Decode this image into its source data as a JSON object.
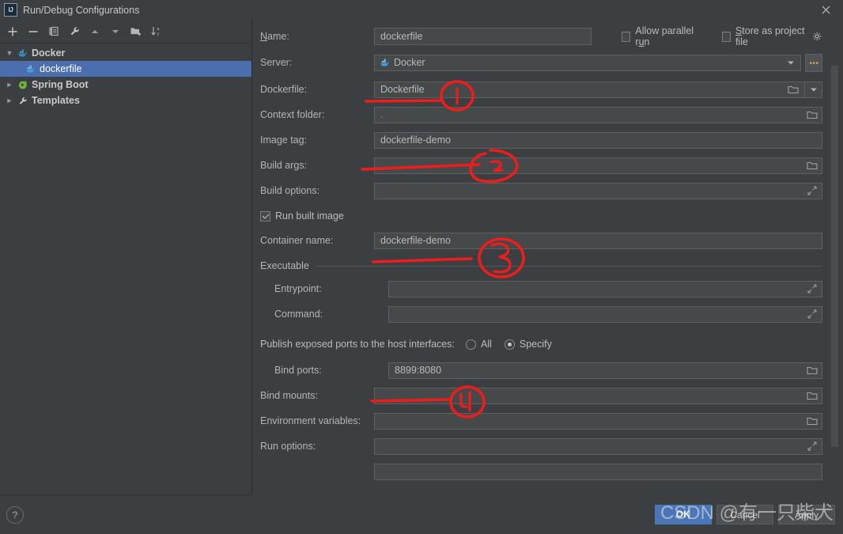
{
  "window": {
    "title": "Run/Debug Configurations",
    "logo_text": "IJ",
    "close_icon": "close-icon"
  },
  "toolbar": {
    "items": [
      {
        "name": "add-configuration-button",
        "icon": "plus-icon",
        "tooltip": "Add New Configuration"
      },
      {
        "name": "remove-configuration-button",
        "icon": "minus-icon",
        "tooltip": "Remove Configuration"
      },
      {
        "name": "copy-configuration-button",
        "icon": "copy-icon",
        "tooltip": "Copy Configuration"
      },
      {
        "name": "edit-templates-button",
        "icon": "wrench-icon",
        "tooltip": "Edit Templates"
      },
      {
        "name": "move-up-button",
        "icon": "arrow-up-icon",
        "tooltip": "Move Up"
      },
      {
        "name": "move-down-button",
        "icon": "arrow-down-icon",
        "tooltip": "Move Down"
      },
      {
        "name": "move-into-folder-button",
        "icon": "folder-add-icon",
        "tooltip": "Move into new folder"
      },
      {
        "name": "sort-configurations-button",
        "icon": "sort-az-icon",
        "tooltip": "Sort Configurations"
      }
    ]
  },
  "tree": {
    "nodes": [
      {
        "label": "Docker",
        "icon": "docker-icon",
        "twisty": "expanded",
        "selected": false,
        "indent": false
      },
      {
        "label": "dockerfile",
        "icon": "docker-icon",
        "twisty": "none",
        "selected": true,
        "indent": true
      },
      {
        "label": "Spring Boot",
        "icon": "spring-icon",
        "twisty": "collapsed",
        "selected": false,
        "indent": false
      },
      {
        "label": "Templates",
        "icon": "wrench-icon",
        "twisty": "collapsed",
        "selected": false,
        "indent": false
      }
    ]
  },
  "form": {
    "name": {
      "label": "Name:",
      "mnemonic": "N",
      "value": "dockerfile"
    },
    "allow_parallel_run": {
      "label_pre": "Allow parallel r",
      "mnemonic": "u",
      "label_post": "n",
      "checked": false
    },
    "store_as_project_file": {
      "mnemonic": "S",
      "label_post": "tore as project file",
      "checked": false,
      "gear_icon": "gear-icon"
    },
    "server": {
      "label": "Server:",
      "value": "Docker",
      "icon": "docker-icon",
      "dropdown_icon": "chevron-down-icon",
      "browse_label": "..."
    },
    "dockerfile": {
      "label": "Dockerfile:",
      "value": "Dockerfile",
      "folder_icon": "folder-icon",
      "dropdown_icon": "chevron-down-icon"
    },
    "context_folder": {
      "label": "Context folder:",
      "value": ".",
      "folder_icon": "folder-icon"
    },
    "image_tag": {
      "label": "Image tag:",
      "value": "dockerfile-demo"
    },
    "build_args": {
      "label": "Build args:",
      "value": "",
      "folder_icon": "folder-icon"
    },
    "build_options": {
      "label": "Build options:",
      "value": "",
      "expand_icon": "expand-icon"
    },
    "run_built_image": {
      "label": "Run built image",
      "checked": true
    },
    "container_name": {
      "label": "Container name:",
      "value": "dockerfile-demo"
    },
    "executable_section": {
      "title": "Executable"
    },
    "entrypoint": {
      "label": "Entrypoint:",
      "value": "",
      "expand_icon": "expand-icon"
    },
    "command": {
      "label": "Command:",
      "value": "",
      "expand_icon": "expand-icon"
    },
    "publish_ports": {
      "label": "Publish exposed ports to the host interfaces:",
      "options": [
        {
          "label": "All",
          "selected": false
        },
        {
          "label": "Specify",
          "selected": true
        }
      ]
    },
    "bind_ports": {
      "label": "Bind ports:",
      "value": "8899:8080",
      "folder_icon": "folder-icon"
    },
    "bind_mounts": {
      "label": "Bind mounts:",
      "value": "",
      "folder_icon": "folder-icon"
    },
    "environment_variables": {
      "label": "Environment variables:",
      "value": "",
      "folder_icon": "folder-icon"
    },
    "run_options": {
      "label": "Run options:",
      "value": "",
      "expand_icon": "expand-icon"
    }
  },
  "annotations": {
    "marks": [
      {
        "number": "1",
        "target": "dockerfile-field"
      },
      {
        "number": "2",
        "target": "image-tag-field"
      },
      {
        "number": "3",
        "target": "container-name-field"
      },
      {
        "number": "4",
        "target": "bind-ports-field"
      }
    ],
    "color": "#ee1c1c"
  },
  "bottom": {
    "help_icon": "question-mark-icon",
    "buttons": [
      {
        "label": "OK",
        "primary": true,
        "name": "ok-button"
      },
      {
        "label": "Cancel",
        "primary": false,
        "name": "cancel-button"
      },
      {
        "label": "Apply",
        "primary": false,
        "name": "apply-button"
      }
    ]
  },
  "watermark": {
    "text": "CSDN @有一只柴犬"
  },
  "colors": {
    "background": "#3c3f41",
    "field_bg": "#45494a",
    "selection": "#4b6eaf",
    "accent_button": "#4a76b8",
    "annotation_red": "#ee1c1c"
  }
}
